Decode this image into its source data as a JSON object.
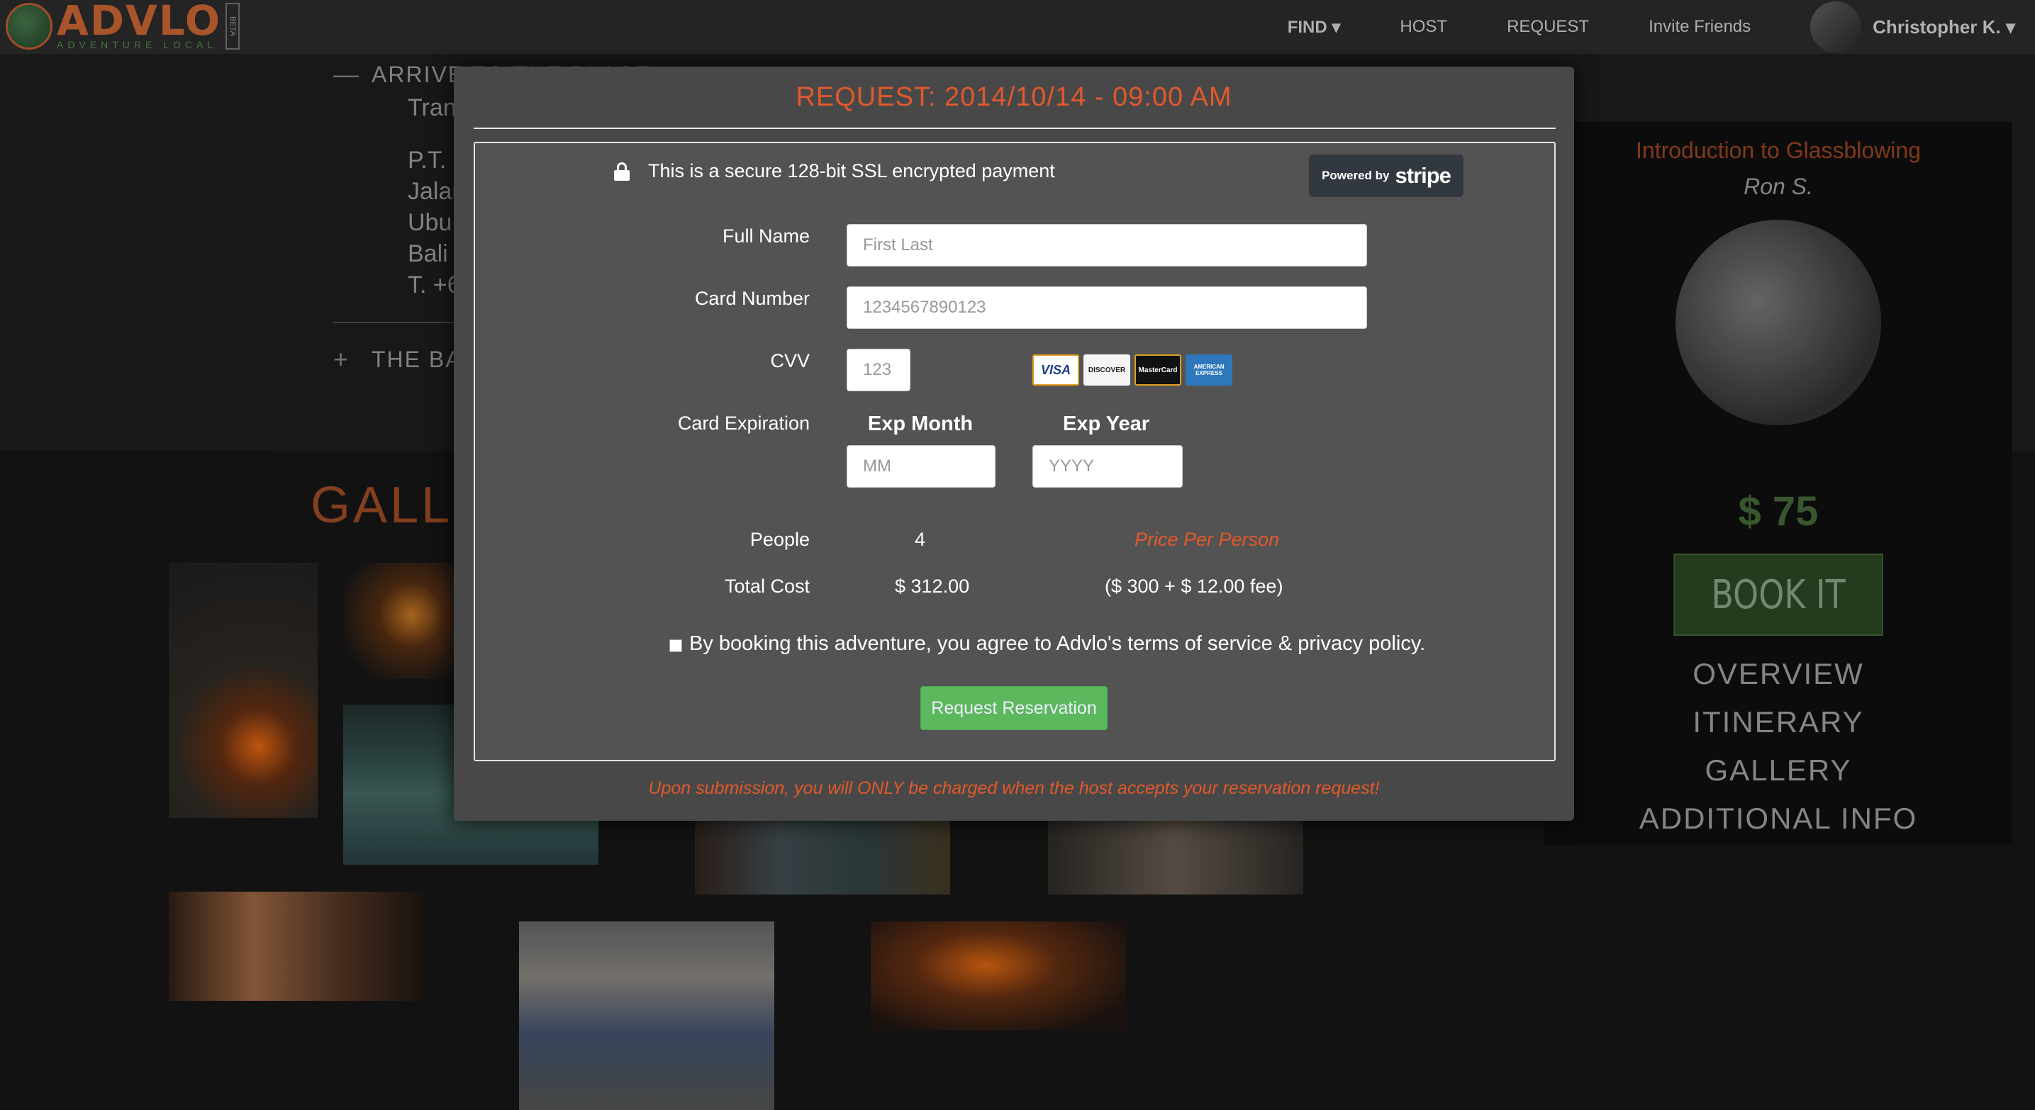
{
  "nav": {
    "logo_word": "ADVLO",
    "logo_tagline": "ADVENTURE LOCAL",
    "logo_badge": "BETA",
    "links": [
      {
        "label": "FIND ▾"
      },
      {
        "label": "HOST"
      },
      {
        "label": "REQUEST"
      },
      {
        "label": "Invite Friends"
      }
    ],
    "user_name": "Christopher K. ▾"
  },
  "background": {
    "accordion_1_title": "ARRIVE TO THE PLACE",
    "accordion_1_lines": [
      "Tran",
      "P.T.",
      "Jalan",
      "Ubu",
      "Bali",
      "T. +6"
    ],
    "accordion_2_title": "THE BA",
    "gallery_title": "GALLE",
    "sidebar": {
      "title": "Introduction to Glassblowing",
      "host": "Ron S.",
      "price": "$ 75",
      "book_label": "BOOK IT",
      "links": [
        "OVERVIEW",
        "ITINERARY",
        "GALLERY",
        "ADDITIONAL INFO"
      ]
    }
  },
  "modal": {
    "title": "REQUEST: 2014/10/14 - 09:00 AM",
    "secure_text": "This is a secure 128-bit SSL encrypted payment",
    "stripe_powered": "Powered by",
    "stripe_word": "stripe",
    "fields": {
      "full_name_label": "Full Name",
      "full_name_placeholder": "First Last",
      "card_number_label": "Card Number",
      "card_number_placeholder": "1234567890123",
      "cvv_label": "CVV",
      "cvv_placeholder": "123",
      "expiration_label": "Card Expiration",
      "exp_month_head": "Exp Month",
      "exp_month_placeholder": "MM",
      "exp_year_head": "Exp Year",
      "exp_year_placeholder": "YYYY"
    },
    "card_logos": [
      "VISA",
      "DISCOVER",
      "MasterCard",
      "AMERICAN EXPRESS"
    ],
    "summary": {
      "people_label": "People",
      "people_value": "4",
      "price_per_person": "Price Per Person",
      "total_label": "Total Cost",
      "total_value": "$ 312.00",
      "total_breakdown": "($ 300 + $ 12.00 fee)"
    },
    "agree_text": "By booking this adventure, you agree to Advlo's terms of service & privacy policy.",
    "request_button": "Request Reservation",
    "notice": "Upon submission, you will ONLY be charged when the host accepts your reservation request!"
  }
}
